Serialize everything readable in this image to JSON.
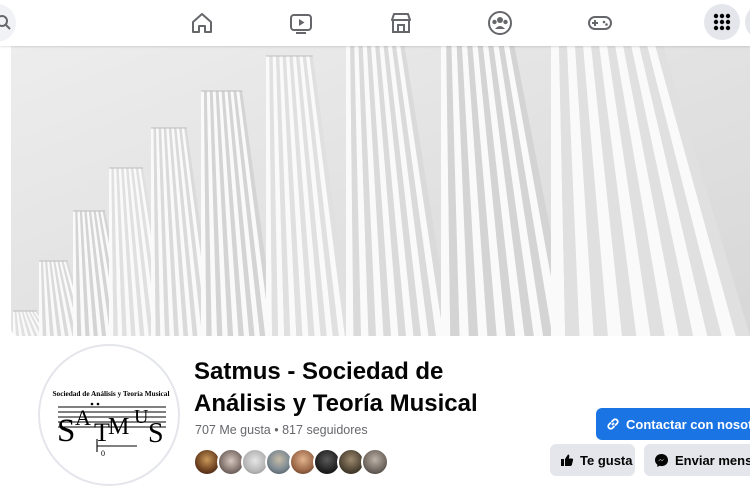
{
  "nav": {
    "icons": [
      "search-icon",
      "home-icon",
      "video-icon",
      "marketplace-icon",
      "groups-icon",
      "gaming-icon",
      "menu-grid-icon"
    ]
  },
  "cover": {
    "description_icon": "cover-photo"
  },
  "profile": {
    "logo_text": "Sociedad de Análisis y Teoría Musical",
    "logo_mark": "SATMUS",
    "name_line1": "Satmus - Sociedad de",
    "name_line2": "Análisis y Teoría Musical",
    "likes": "707 Me gusta",
    "separator": "•",
    "followers": "817 seguidores"
  },
  "actions": {
    "contact_label": "Contactar con nosotros",
    "like_label": "Te gusta",
    "message_label": "Enviar mensaje"
  },
  "colors": {
    "accent": "#1b74e4",
    "button_gray": "#e4e6eb",
    "text_primary": "#050505",
    "text_secondary": "#65676b"
  }
}
